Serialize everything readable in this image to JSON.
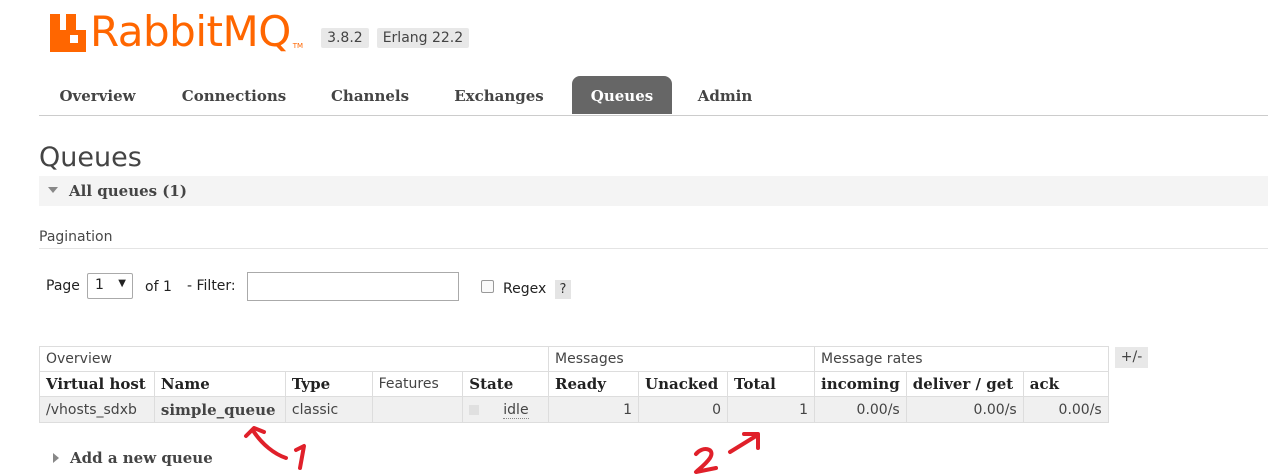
{
  "app": {
    "logo_text": "RabbitMQ",
    "logo_tm": "TM",
    "version": "3.8.2",
    "erlang": "Erlang 22.2"
  },
  "tabs": [
    {
      "label": "Overview",
      "active": false
    },
    {
      "label": "Connections",
      "active": false
    },
    {
      "label": "Channels",
      "active": false
    },
    {
      "label": "Exchanges",
      "active": false
    },
    {
      "label": "Queues",
      "active": true
    },
    {
      "label": "Admin",
      "active": false
    }
  ],
  "page": {
    "title": "Queues",
    "section_label": "All queues (1)"
  },
  "pagination": {
    "heading": "Pagination",
    "page_label": "Page",
    "page_value": "1",
    "of_label": "of 1",
    "filter_label": "- Filter:",
    "filter_value": "",
    "regex_label": "Regex",
    "regex_checked": false,
    "help_label": "?"
  },
  "table": {
    "groups": [
      "Overview",
      "Messages",
      "Message rates"
    ],
    "columns_toggle": "+/-",
    "columns": [
      "Virtual host",
      "Name",
      "Type",
      "Features",
      "State",
      "Ready",
      "Unacked",
      "Total",
      "incoming",
      "deliver / get",
      "ack"
    ],
    "rows": [
      {
        "virtual_host": "/vhosts_sdxb",
        "name": "simple_queue",
        "type": "classic",
        "features": "",
        "state": "idle",
        "ready": "1",
        "unacked": "0",
        "total": "1",
        "incoming": "0.00/s",
        "deliver_get": "0.00/s",
        "ack": "0.00/s"
      }
    ]
  },
  "add_queue": {
    "label": "Add a new queue"
  },
  "annotations": {
    "mark_1": "1",
    "mark_2": "2",
    "color": "#e0202a"
  },
  "colors": {
    "brand": "#ff6600",
    "active_tab": "#666666"
  }
}
